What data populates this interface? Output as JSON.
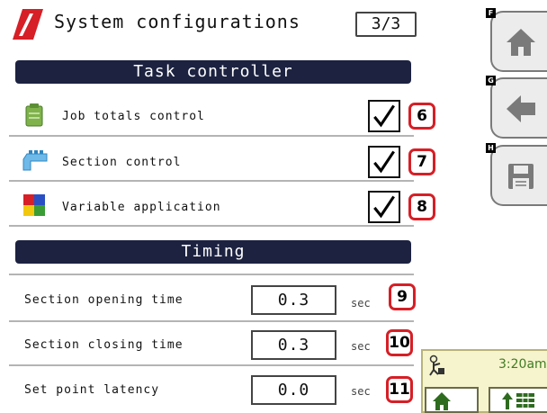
{
  "header": {
    "title": "System configurations",
    "page_indicator": "3/3"
  },
  "task_controller": {
    "heading": "Task controller",
    "items": [
      {
        "label": "Job totals control",
        "checked": true,
        "callout": "6",
        "icon": "job-totals-icon"
      },
      {
        "label": "Section control",
        "checked": true,
        "callout": "7",
        "icon": "section-control-icon"
      },
      {
        "label": "Variable application",
        "checked": true,
        "callout": "8",
        "icon": "variable-application-icon"
      }
    ]
  },
  "timing": {
    "heading": "Timing",
    "rows": [
      {
        "label": "Section opening time",
        "value": "0.3",
        "unit": "sec",
        "callout": "9"
      },
      {
        "label": "Section closing time",
        "value": "0.3",
        "unit": "sec",
        "callout": "10"
      },
      {
        "label": "Set point latency",
        "value": "0.0",
        "unit": "sec",
        "callout": "11"
      }
    ]
  },
  "side_buttons": [
    {
      "key": "F",
      "icon": "home-icon"
    },
    {
      "key": "G",
      "icon": "back-arrow-icon"
    },
    {
      "key": "H",
      "icon": "save-icon"
    }
  ],
  "status": {
    "time": "3:20am",
    "icon": "operator-icon",
    "nav_buttons": [
      "home-icon",
      "up-arrow-grid-icon"
    ]
  },
  "colors": {
    "section_bar": "#1c2240",
    "callout_border": "#d61f26",
    "status_panel": "#f6f4cc",
    "status_time": "#3f7c24",
    "logo_red": "#d61f26"
  }
}
